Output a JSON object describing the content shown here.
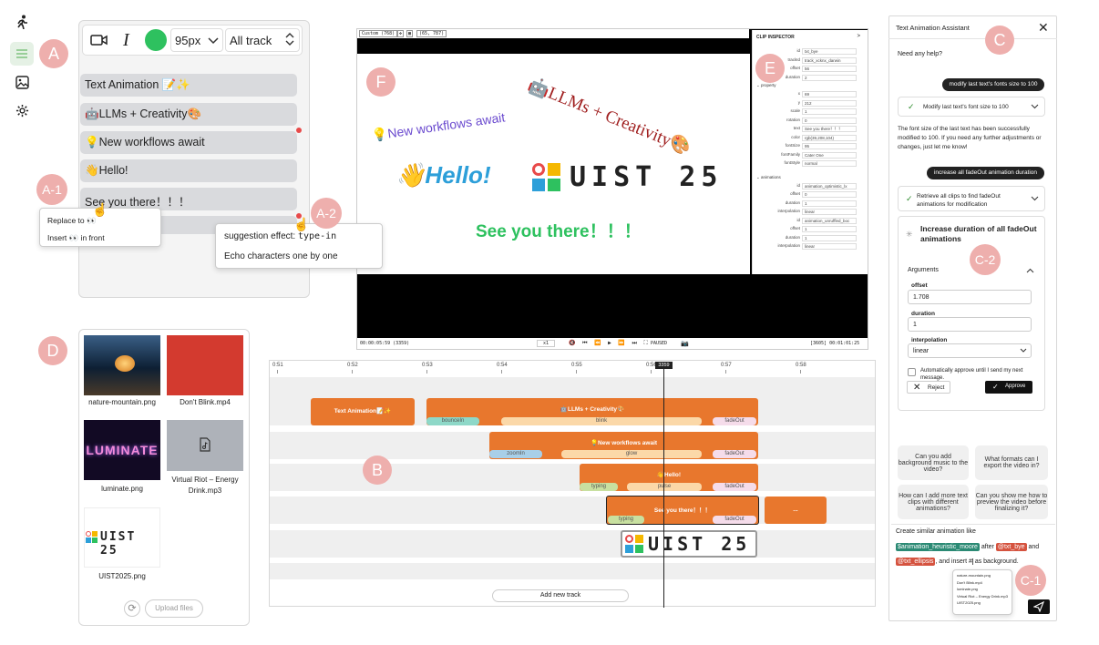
{
  "sidebar": {
    "icons": [
      "runner-icon",
      "menu-icon",
      "image-icon",
      "gear-icon"
    ]
  },
  "badges": {
    "a": "A",
    "a1": "A-1",
    "a2": "A-2",
    "b": "B",
    "c": "C",
    "c1": "C-1",
    "c2": "C-2",
    "d": "D",
    "e": "E",
    "f": "F"
  },
  "toolbar": {
    "font_size": "95px",
    "track": "All track"
  },
  "text_list": [
    "Text Animation 📝✨",
    "🤖LLMs + Creativity🎨",
    "💡New workflows await",
    "👋Hello!",
    "See you there！！！"
  ],
  "context_menu": {
    "replace": "Replace to 👀",
    "insert": "Insert 👀 in front"
  },
  "suggestion": {
    "prefix": "suggestion effect: ",
    "code": "type-in",
    "desc": "Echo characters one by one"
  },
  "media": {
    "files": [
      {
        "name": "nature-mountain.png",
        "color": "#1c3a5a"
      },
      {
        "name": "Don't Blink.mp4",
        "color": "#d33a2f"
      },
      {
        "name": "luminate.png",
        "color": "#120a24"
      },
      {
        "name": "Virtual Riot – Energy Drink.mp3",
        "color": "#aeb2b9"
      },
      {
        "name": "UIST2025.png",
        "color": "#ffffff"
      }
    ],
    "luminate_text": "LUMINATE",
    "upload": "Upload files"
  },
  "preview": {
    "res": "Custom (768)",
    "coord": "(65, 787)",
    "llms": "🤖LLMs + Creativity🎨",
    "workflows": "💡New workflows await",
    "hello": "👋Hello!",
    "uist": "UIST 25",
    "see": "See you there！！！",
    "time_left": "00:00:05:59 (3359)",
    "speed": "x1",
    "paused": "PAUSED",
    "time_right": "[3605] 00:01:01:25"
  },
  "inspector": {
    "title": "CLIP INSPECTOR",
    "arrow": ">",
    "top": [
      [
        "id",
        "txt_bye"
      ],
      [
        "trackId",
        "track_xcknx_darwin"
      ],
      [
        "offset",
        "56"
      ],
      [
        "duration",
        "2"
      ]
    ],
    "property_label": "property",
    "props": [
      [
        "x",
        "69"
      ],
      [
        "y",
        "212"
      ],
      [
        "scale",
        "1"
      ],
      [
        "rotation",
        "0"
      ],
      [
        "text",
        "See you there！！！"
      ],
      [
        "color",
        "rgb(39,208,104)"
      ],
      [
        "fontSize",
        "95"
      ],
      [
        "fontFamily",
        "Cater One"
      ],
      [
        "fontStyle",
        "normal"
      ]
    ],
    "anim_label": "animations",
    "anims": [
      [
        "id",
        "animation_optimistic_lx"
      ],
      [
        "offset",
        "0"
      ],
      [
        "duration",
        "1"
      ],
      [
        "interpolation",
        "linear"
      ],
      [
        "id",
        "animation_unruffled_boc"
      ],
      [
        "offset",
        "1"
      ],
      [
        "duration",
        "1"
      ],
      [
        "interpolation",
        "linear"
      ]
    ]
  },
  "timeline": {
    "ticks": [
      "0:51",
      "0:52",
      "0:53",
      "0:54",
      "0:55",
      "0:56",
      "0:57",
      "0:58"
    ],
    "playhead": "3359",
    "clips": {
      "text_anim": "Text Animation📝✨",
      "llms": "🤖LLMs + Creativity🎨",
      "workflows": "💡New workflows await",
      "hello": "👋Hello!",
      "see": "See you there！！！",
      "dots": "...",
      "uist": "UIST 25"
    },
    "subs": {
      "bounce": "bounceIn",
      "blink": "blink",
      "fade": "fadeOut",
      "zoom": "zoomIn",
      "glow": "glow",
      "typing": "typing",
      "pulse": "pulse"
    },
    "add_track": "Add new track"
  },
  "assistant": {
    "title": "Text Animation Assistant",
    "help": "Need any help?",
    "msg1": "modify last text's fonts size to 100",
    "tool1": "Modify last text's font size to 100",
    "reply1": "The font size of the last text has been successfully modified to 100. If you need any further adjustments or changes, just let me know!",
    "msg2": "increase all fadeOut animation duration",
    "tool2": "Retrieve all clips to find fadeOut animations for modification",
    "card_title": "Increase duration of all fadeOut animations",
    "arguments": "Arguments",
    "offset_label": "offset",
    "offset_val": "1.708",
    "duration_label": "duration",
    "duration_val": "1",
    "interp_label": "interpolation",
    "interp_val": "linear",
    "auto": "Automatically approve until I send my next message.",
    "reject": "Reject",
    "approve": "Approve",
    "suggestions": [
      "Can you add background music to the video?",
      "What formats can I export the video in?",
      "How can I add more text clips with different animations?",
      "Can you show me how to preview the video before finalizing it?"
    ],
    "compose_label": "Create similar animation like",
    "chip_anim": "$animation_heuristic_moore",
    "after": " after ",
    "chip_bye": "@txt_bye",
    "and": " and",
    "chip_ellipsis": "@txt_ellipsis",
    "insert_text": ", and insert #",
    "as_bg": " as background.",
    "dropdown": [
      "nature-mountain.png",
      "Don't Blink.mp4",
      "luminate.png",
      "Virtual Riot – Energy Drink.mp3",
      "UIST2025.png"
    ]
  },
  "colors": {
    "orange": "#e8772d",
    "green": "#2ec15f",
    "badge": "#eeafad",
    "teal": "#2b8a74",
    "red_chip": "#d5533f"
  }
}
